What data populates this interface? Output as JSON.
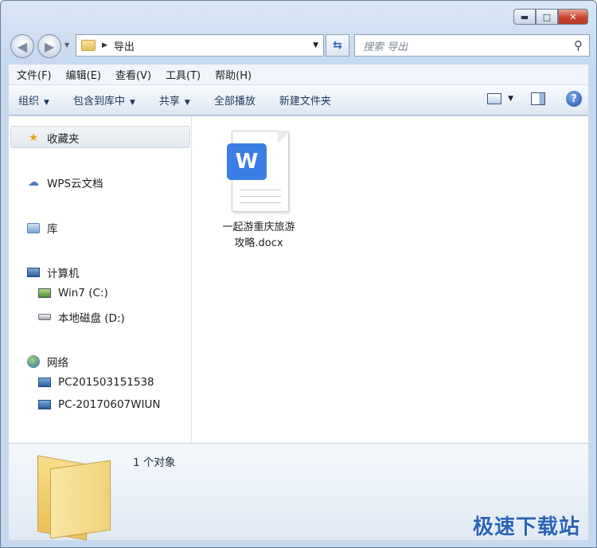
{
  "window": {
    "caption_buttons": {
      "minimize": "▬",
      "maximize": "□",
      "close": "✕"
    }
  },
  "address": {
    "crumb": "导出",
    "search_placeholder": "搜索 导出"
  },
  "menu": [
    "文件(F)",
    "编辑(E)",
    "查看(V)",
    "工具(T)",
    "帮助(H)"
  ],
  "toolbar": {
    "organize": "组织",
    "include_library": "包含到库中",
    "share": "共享",
    "play_all": "全部播放",
    "new_folder": "新建文件夹",
    "help": "?"
  },
  "sidebar": {
    "favorites": "收藏夹",
    "wps_cloud": "WPS云文档",
    "library": "库",
    "computer": "计算机",
    "drive_c": "Win7 (C:)",
    "drive_d": "本地磁盘 (D:)",
    "network": "网络",
    "pc1": "PC201503151538",
    "pc2": "PC-20170607WIUN"
  },
  "files": [
    {
      "name_line1": "一起游重庆旅游",
      "name_line2": "攻略.docx",
      "badge": "W"
    }
  ],
  "details": {
    "count": "1 个对象"
  },
  "watermark": "极速下载站"
}
